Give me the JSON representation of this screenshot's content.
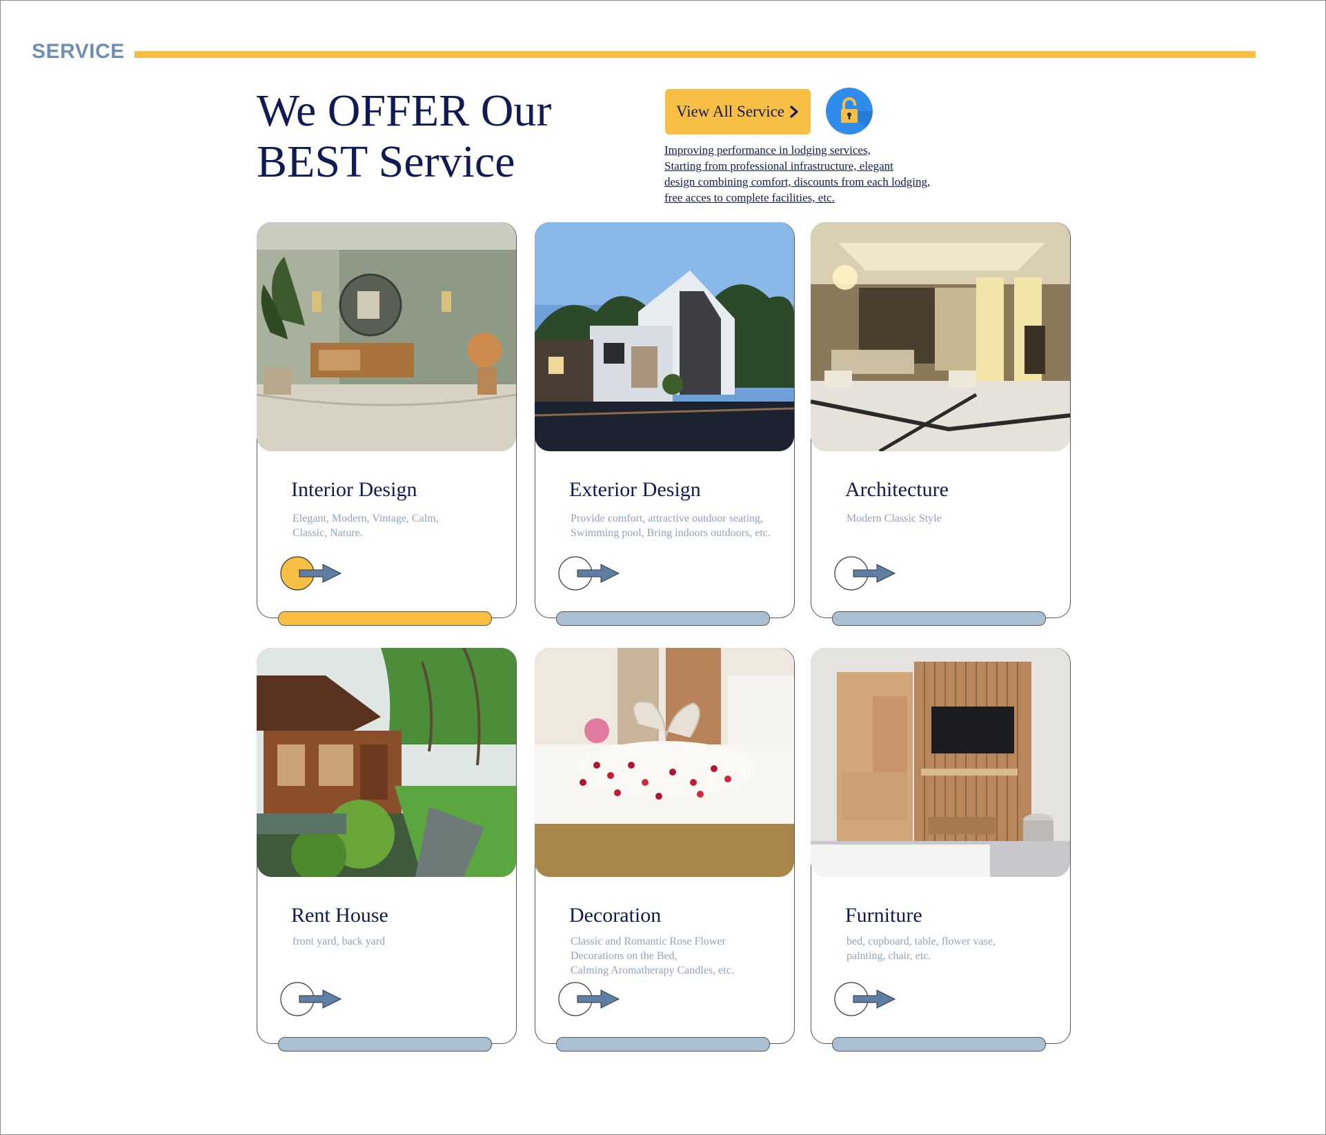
{
  "section": {
    "label": "SERVICE"
  },
  "hero": {
    "headline_line1": "We OFFER Our",
    "headline_line2": "BEST Service",
    "cta_label": "View All Service",
    "intro_lines": [
      "Improving performance in lodging services,",
      "Starting from professional infrastructure, elegant",
      "design combining comfort, discounts from each lodging,",
      "free acces to complete facilities, etc."
    ]
  },
  "icons": {
    "cta": "chevron-right-icon",
    "lock": "unlock-icon",
    "card_link": "arrow-right-icon"
  },
  "colors": {
    "accent": "#f7bf43",
    "navy": "#101a55",
    "muted_blue": "#8fa3bc",
    "bar_inactive": "#a9c0d3",
    "section_label": "#6f8fb4",
    "lock_circle": "#2f8cea"
  },
  "cards": [
    {
      "title": "Interior Design",
      "desc": [
        "Elegant, Modern, Vintage, Calm,",
        "Classic, Nature."
      ],
      "active": true,
      "photo": "interior-living-room"
    },
    {
      "title": "Exterior Design",
      "desc": [
        "Provide comfort, attractive outdoor seating,",
        "Swimming pool, Bring indoors outdoors, etc."
      ],
      "active": false,
      "photo": "modern-house-exterior"
    },
    {
      "title": "Architecture",
      "desc": [
        "Modern Classic Style"
      ],
      "active": false,
      "photo": "hotel-lobby"
    },
    {
      "title": "Rent House",
      "desc": [
        "front yard, back yard"
      ],
      "active": false,
      "photo": "wooden-house-garden"
    },
    {
      "title": "Decoration",
      "desc": [
        "Classic and Romantic Rose Flower",
        "Decorations on the Bed,",
        "Calming Aromatherapy Candles, etc."
      ],
      "active": false,
      "photo": "rose-petal-bed"
    },
    {
      "title": "Furniture",
      "desc": [
        "bed, cupboard, table, flower vase,",
        "painting, chair, etc."
      ],
      "active": false,
      "photo": "bedroom-furniture"
    }
  ]
}
